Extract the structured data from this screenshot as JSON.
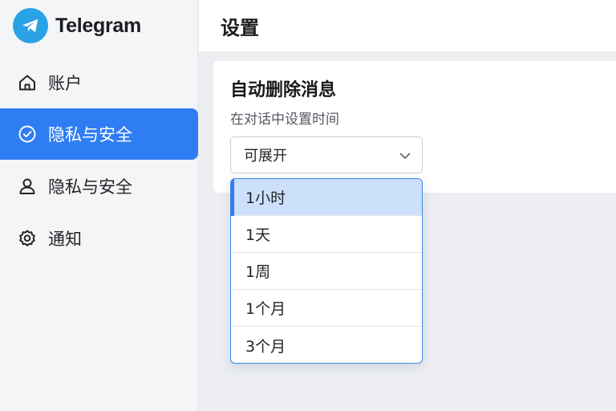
{
  "app": {
    "name": "Telegram",
    "accent": "#2f7df3",
    "logo_color": "#2aa3e6"
  },
  "sidebar": {
    "items": [
      {
        "label": "账户",
        "icon": "home-icon",
        "active": false
      },
      {
        "label": "隐私与安全",
        "icon": "check-circle-icon",
        "active": true
      },
      {
        "label": "隐私与安全",
        "icon": "user-icon",
        "active": false
      },
      {
        "label": "通知",
        "icon": "gear-icon",
        "active": false
      }
    ]
  },
  "header": {
    "title": "设置"
  },
  "card": {
    "title": "自动删除消息",
    "description": "在对话中设置时间",
    "select": {
      "value": "可展开",
      "icon": "chevron-down-icon"
    }
  },
  "dropdown": {
    "selected_index": 0,
    "options": [
      "1小时",
      "1天",
      "1周",
      "1个月",
      "3个月"
    ]
  }
}
